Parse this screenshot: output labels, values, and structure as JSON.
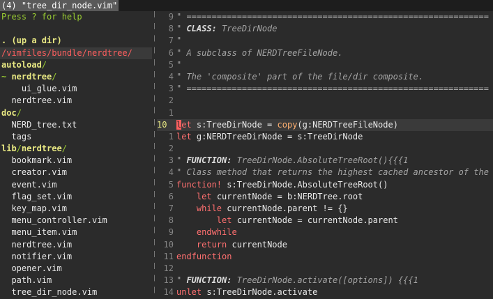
{
  "tabline": {
    "active_tab": "(4) \"tree_dir_node.vim\""
  },
  "tree": {
    "help": "Press ? for help",
    "updir": ". (up a dir)",
    "cwd": "/vimfiles/bundle/nerdtree/",
    "autoload_dir": "autoload",
    "nerdtree_tilde": "~ ",
    "nerdtree_dir": "nerdtree",
    "slash": "/",
    "doc_dir": "doc",
    "lib_dir": "lib",
    "lib_nerdtree_dir": "nerdtree",
    "files": {
      "ui_glue": "ui_glue.vim",
      "nerdtree_vim": "nerdtree.vim",
      "nerd_tree_txt": "NERD_tree.txt",
      "tags": "tags",
      "bookmark": "bookmark.vim",
      "creator": "creator.vim",
      "event": "event.vim",
      "flag_set": "flag_set.vim",
      "key_map": "key_map.vim",
      "menu_controller": "menu_controller.vim",
      "menu_item": "menu_item.vim",
      "lib_nerdtree": "nerdtree.vim",
      "notifier": "notifier.vim",
      "opener": "opener.vim",
      "path": "path.vim",
      "tree_dir_node": "tree_dir_node.vim"
    }
  },
  "code": {
    "rule": "\" ============================================================",
    "l8a": "\" ",
    "l8b": "CLASS:",
    "l8c": " TreeDirNode",
    "quote": "\"",
    "l6": "\" A subclass of NERDTreeFileNode.",
    "l4": "\" The 'composite' part of the file/dir composite.",
    "cur_char": "l",
    "cur_rest_kw": "et",
    "cur_id1": " s:TreeDirNode = ",
    "cur_fn": "copy",
    "cur_id2": "(g:NERDTreeFileNode)",
    "let": "let",
    "a1_id": " g:NERDTreeDirNode = s:TreeDirNode",
    "func_label": "FUNCTION:",
    "a3_rest": " TreeDirNode.AbsoluteTreeRoot(){{{1",
    "a4": "\" Class method that returns the highest cached ancestor of the",
    "function_kw": "function!",
    "a5_id": " s:TreeDirNode.AbsoluteTreeRoot()",
    "a6_id": " currentNode = b:NERDTree.root",
    "while_kw": "while",
    "a7_id": " currentNode.parent != {}",
    "a8_id": " currentNode = currentNode.parent",
    "endwhile_kw": "endwhile",
    "return_kw": "return",
    "a10_id": " currentNode",
    "endfunction_kw": "endfunction",
    "a13_rest": " TreeDirNode.activate([options]) {{{1",
    "unlet_kw": "unlet",
    "a14_id": " s:TreeDirNode.activate"
  },
  "gutter": {
    "r9": "9",
    "r8": "8",
    "r7": "7",
    "r6": "6",
    "r5": "5",
    "r4": "4",
    "r3": "3",
    "r2": "2",
    "r1": "1",
    "cur": "10",
    "a1": "1",
    "a2": "2",
    "a3": "3",
    "a4": "4",
    "a5": "5",
    "a6": "6",
    "a7": "7",
    "a8": "8",
    "a9": "9",
    "a10": "10",
    "a11": "11",
    "a12": "12",
    "a13": "13",
    "a14": "14"
  },
  "colors": {
    "background": "#2b2b2b",
    "directory": "#e9e983",
    "help": "#9acd32",
    "cwd": "#ff5f5f",
    "keyword": "#ff7070",
    "function": "#ffb070",
    "comment": "#a4a4a4",
    "line_number": "#858585"
  }
}
